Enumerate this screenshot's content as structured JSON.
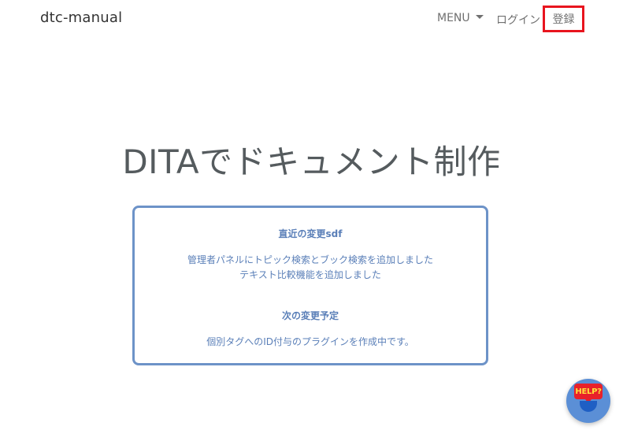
{
  "header": {
    "brand": "dtc-manual",
    "menu_label": "MENU",
    "login_label": "ログイン",
    "register_label": "登録"
  },
  "hero": {
    "title": "DITAでドキュメント制作"
  },
  "info_box": {
    "recent_heading": "直近の変更sdf",
    "recent_items": [
      "管理者パネルにトピック検索とブック検索を追加しました",
      "テキスト比較機能を追加しました"
    ],
    "planned_heading": "次の変更予定",
    "planned_items": [
      "個別タグへのID付与のプラグインを作成中です。"
    ]
  },
  "help_widget": {
    "label": "HELP?",
    "icon": "help-chat-icon"
  },
  "colors": {
    "highlight_border": "#e8141e",
    "box_border": "#6d93c8",
    "box_text": "#5a7fb8",
    "help_button": "#5b8fd6"
  }
}
